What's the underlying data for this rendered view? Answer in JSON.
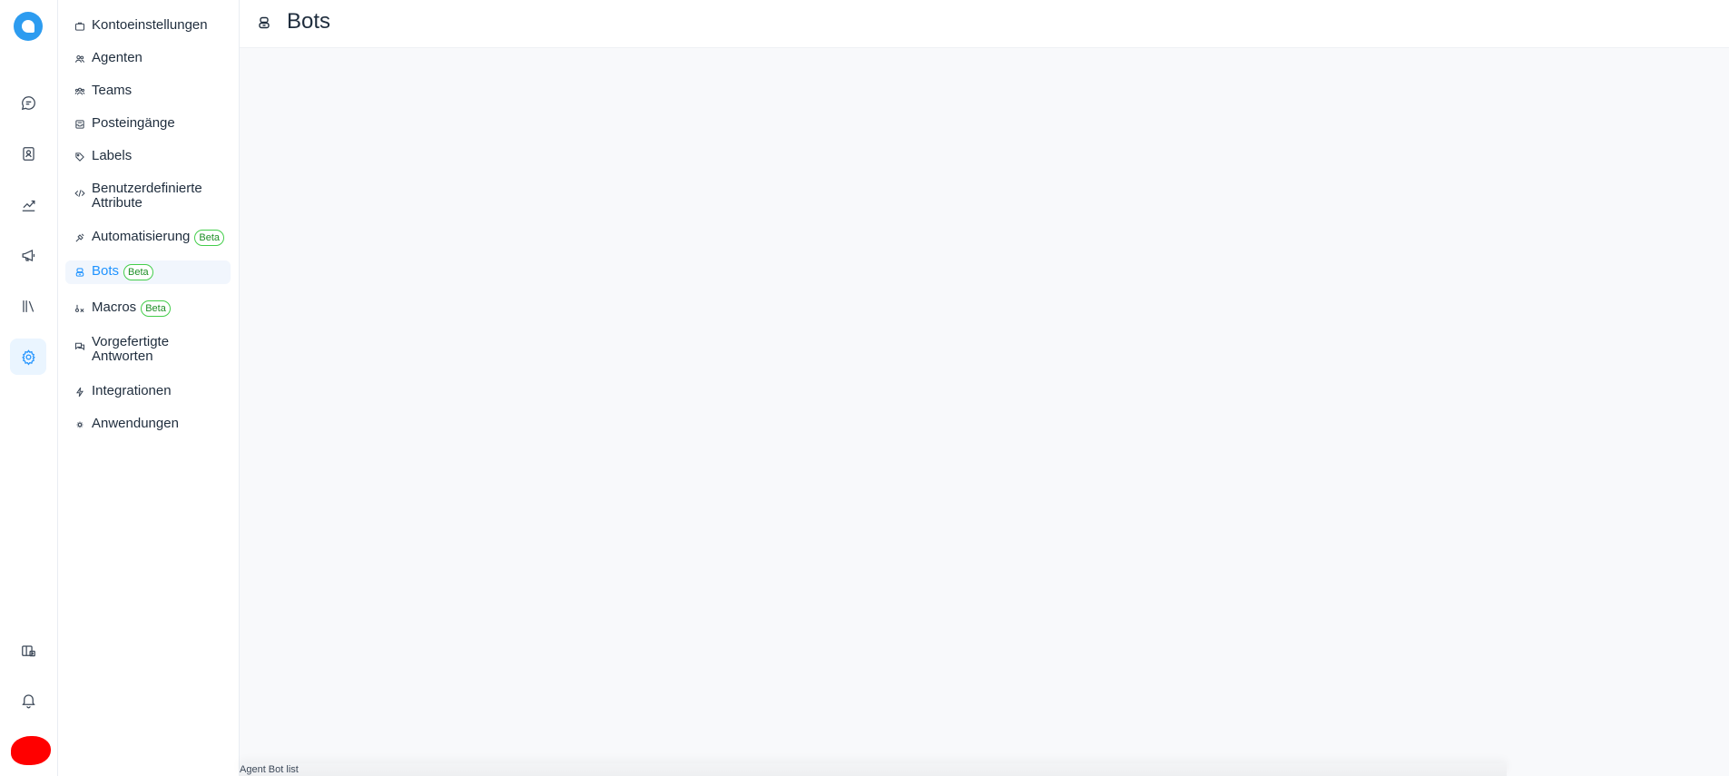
{
  "app": {
    "accent": "#1f93ff",
    "badge_color": "#44ce4b"
  },
  "rail": {
    "items": [
      {
        "name": "conversations",
        "icon": "chat-bubble-icon"
      },
      {
        "name": "contacts",
        "icon": "contact-book-icon"
      },
      {
        "name": "reports",
        "icon": "line-chart-icon"
      },
      {
        "name": "campaigns",
        "icon": "megaphone-icon"
      },
      {
        "name": "library",
        "icon": "library-books-icon"
      },
      {
        "name": "settings",
        "icon": "gear-icon",
        "active": true
      }
    ],
    "bottom": [
      {
        "name": "portal",
        "icon": "switch-account-icon"
      },
      {
        "name": "notifications",
        "icon": "bell-icon"
      }
    ]
  },
  "sidebar": {
    "items": [
      {
        "label": "Kontoeinstellungen",
        "icon": "briefcase-icon"
      },
      {
        "label": "Agenten",
        "icon": "people-icon"
      },
      {
        "label": "Teams",
        "icon": "team-icon"
      },
      {
        "label": "Posteingänge",
        "icon": "inbox-icon"
      },
      {
        "label": "Labels",
        "icon": "tag-icon"
      },
      {
        "label": "Benutzerdefinierte Attribute",
        "icon": "code-icon"
      },
      {
        "label": "Automatisierung",
        "icon": "automation-icon",
        "badge": "Beta"
      },
      {
        "label": "Bots",
        "icon": "bot-icon",
        "badge": "Beta",
        "active": true
      },
      {
        "label": "Macros",
        "icon": "macro-icon",
        "badge": "Beta"
      },
      {
        "label": "Vorgefertigte Antworten",
        "icon": "canned-response-icon"
      },
      {
        "label": "Integrationen",
        "icon": "flash-icon"
      },
      {
        "label": "Anwendungen",
        "icon": "apps-icon"
      }
    ]
  },
  "header": {
    "title": "Bots",
    "icon": "bot-icon"
  },
  "footer": {
    "text": "Agent Bot list"
  }
}
